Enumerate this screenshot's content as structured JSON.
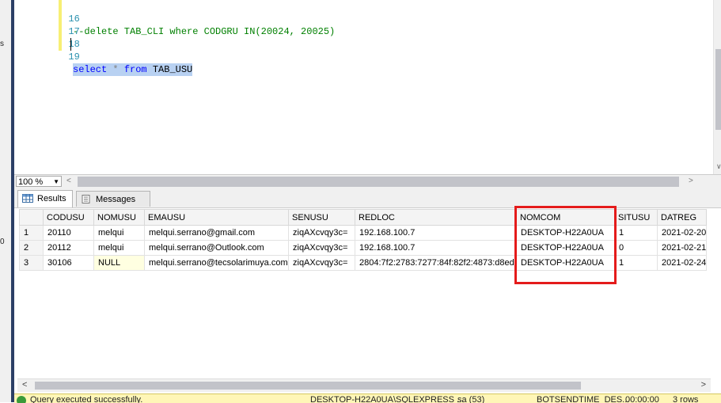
{
  "left_strip": {
    "frag_top": "s",
    "frag_mid": "0"
  },
  "editor": {
    "lines": [
      {
        "number": "16",
        "text": "--delete TAB_CLI where CODGRU IN(20024, 20025)"
      },
      {
        "number": "17",
        "text": ""
      },
      {
        "number": "18",
        "text": ""
      },
      {
        "number": "19",
        "kw1": "select",
        "star": "*",
        "kw2": "from",
        "ident": "TAB_USU"
      }
    ]
  },
  "zoom": {
    "value": "100 %"
  },
  "tabs": {
    "results": "Results",
    "messages": "Messages"
  },
  "grid": {
    "columns": [
      "CODUSU",
      "NOMUSU",
      "EMAUSU",
      "SENUSU",
      "REDLOC",
      "NOMCOM",
      "SITUSU",
      "DATREG"
    ],
    "rows": [
      {
        "n": "1",
        "codusu": "20110",
        "nomusu": "melqui",
        "emausu": "melqui.serrano@gmail.com",
        "senusu": "ziqAXcvqy3c=",
        "redloc": "192.168.100.7",
        "nomcom": "DESKTOP-H22A0UA",
        "situsu": "1",
        "datreg": "2021-02-20"
      },
      {
        "n": "2",
        "codusu": "20112",
        "nomusu": "melqui",
        "emausu": "melqui.serrano@Outlook.com",
        "senusu": "ziqAXcvqy3c=",
        "redloc": "192.168.100.7",
        "nomcom": "DESKTOP-H22A0UA",
        "situsu": "0",
        "datreg": "2021-02-21"
      },
      {
        "n": "3",
        "codusu": "30106",
        "nomusu": "NULL",
        "emausu": "melqui.serrano@tecsolarimuya.com",
        "senusu": "ziqAXcvqy3c=",
        "redloc": "2804:7f2:2783:7277:84f:82f2:4873:d8ed",
        "nomcom": "DESKTOP-H22A0UA",
        "situsu": "1",
        "datreg": "2021-02-24"
      }
    ]
  },
  "status": {
    "message": "Query executed successfully.",
    "server": "DESKTOP-H22A0UA\\SQLEXPRESS ...",
    "user": "sa (53)",
    "db": "BOTSENDTIME_DES...",
    "time": "00:00:00",
    "rows": "3 rows"
  }
}
